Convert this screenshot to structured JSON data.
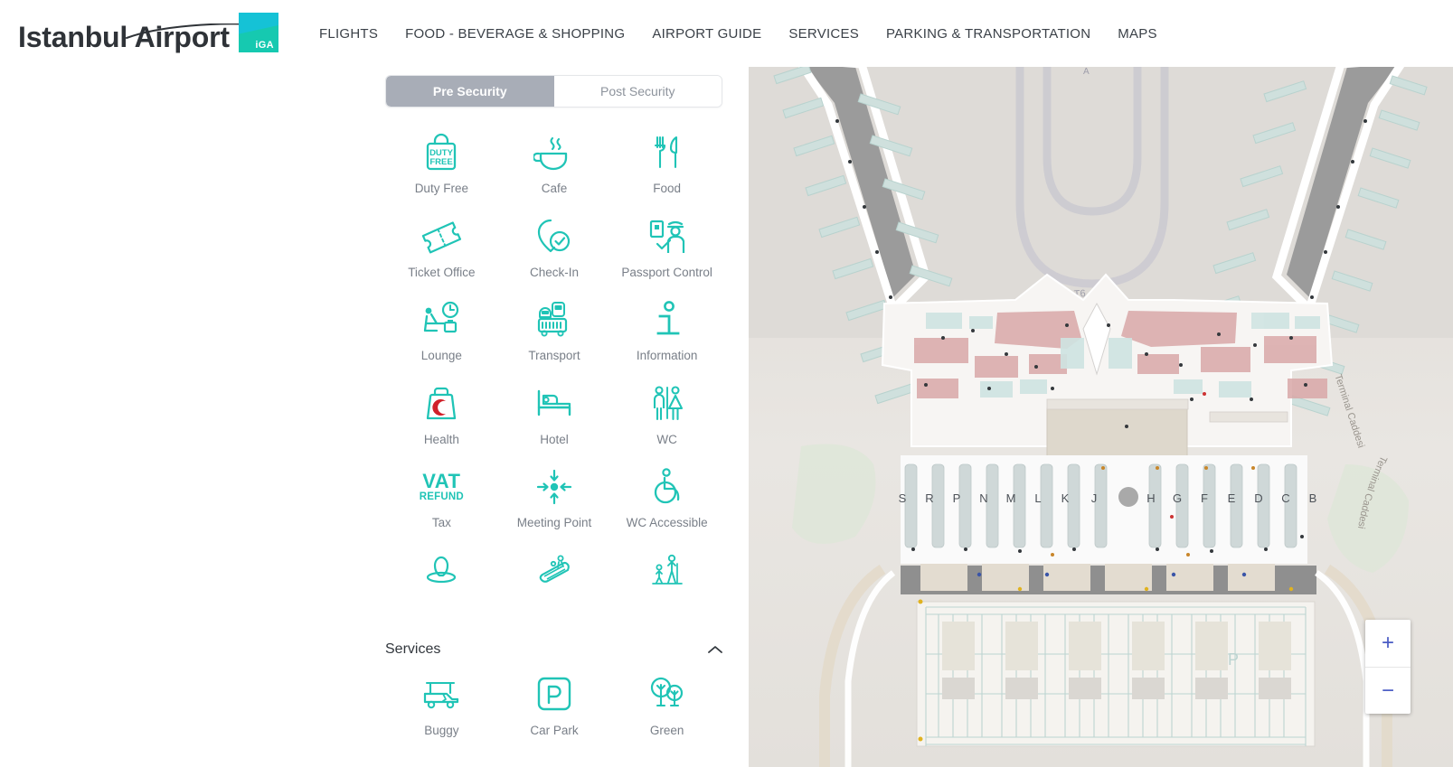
{
  "header": {
    "logo_text": "Istanbul Airport",
    "logo_badge": "iGA",
    "nav": [
      {
        "label": "FLIGHTS",
        "name": "nav-flights"
      },
      {
        "label": "FOOD - BEVERAGE & SHOPPING",
        "name": "nav-food-beverage-shopping"
      },
      {
        "label": "AIRPORT GUIDE",
        "name": "nav-airport-guide"
      },
      {
        "label": "SERVICES",
        "name": "nav-services"
      },
      {
        "label": "PARKING & TRANSPORTATION",
        "name": "nav-parking-transportation"
      },
      {
        "label": "MAPS",
        "name": "nav-maps"
      }
    ]
  },
  "panel": {
    "tabs": [
      {
        "label": "Pre Security",
        "active": true
      },
      {
        "label": "Post Security",
        "active": false
      }
    ],
    "categories": [
      {
        "label": "Duty Free",
        "icon": "duty-free-icon"
      },
      {
        "label": "Cafe",
        "icon": "cafe-icon"
      },
      {
        "label": "Food",
        "icon": "food-icon"
      },
      {
        "label": "Ticket Office",
        "icon": "ticket-office-icon"
      },
      {
        "label": "Check-In",
        "icon": "check-in-icon"
      },
      {
        "label": "Passport Control",
        "icon": "passport-control-icon"
      },
      {
        "label": "Lounge",
        "icon": "lounge-icon"
      },
      {
        "label": "Transport",
        "icon": "transport-icon"
      },
      {
        "label": "Information",
        "icon": "information-icon"
      },
      {
        "label": "Health",
        "icon": "health-icon"
      },
      {
        "label": "Hotel",
        "icon": "hotel-icon"
      },
      {
        "label": "WC",
        "icon": "wc-icon"
      },
      {
        "label": "Tax",
        "icon": "vat-refund-icon"
      },
      {
        "label": "Meeting Point",
        "icon": "meeting-point-icon"
      },
      {
        "label": "WC Accessible",
        "icon": "wc-accessible-icon"
      },
      {
        "label": "",
        "icon": "prayer-room-icon"
      },
      {
        "label": "",
        "icon": "escalator-icon"
      },
      {
        "label": "",
        "icon": "family-icon"
      }
    ],
    "services_section": {
      "title": "Services",
      "expanded": true,
      "items": [
        {
          "label": "Buggy",
          "icon": "buggy-icon"
        },
        {
          "label": "Car Park",
          "icon": "car-park-icon"
        },
        {
          "label": "Green",
          "icon": "green-icon"
        }
      ]
    }
  },
  "map": {
    "zoom_in": "+",
    "zoom_out": "−",
    "checkin_rows": [
      "S",
      "R",
      "P",
      "N",
      "M",
      "L",
      "K",
      "J",
      "H",
      "G",
      "F",
      "E",
      "D",
      "C",
      "B"
    ],
    "road_label": "Terminal Caddesi",
    "taxiway_label": "T6",
    "parking_label": "P"
  },
  "colors": {
    "teal": "#20C4B6",
    "tab_active_bg": "#a8adb7",
    "label_gray": "#797f88",
    "nav_text": "#3b4148",
    "health_red": "#d0212a",
    "zoom_blue": "#4a5cc4"
  }
}
